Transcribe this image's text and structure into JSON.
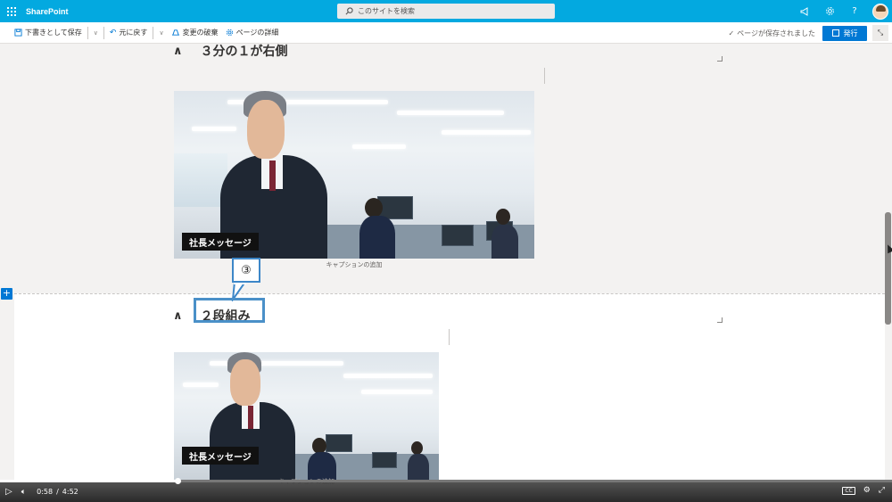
{
  "suite": {
    "brand": "SharePoint",
    "search_placeholder": "このサイトを検索",
    "icons": [
      "megaphone-icon",
      "gear-icon",
      "help-icon",
      "avatar"
    ]
  },
  "commandbar": {
    "save_draft": "下書きとして保存",
    "undo": "元に戻す",
    "discard": "変更の破棄",
    "page_details": "ページの詳細",
    "saved_status": "ページが保存されました",
    "publish": "発行"
  },
  "sections": [
    {
      "title": "３分の１が右側",
      "image_label": "社長メッセージ",
      "caption": "キャプションの追加"
    },
    {
      "title": "２段組み",
      "image_label": "社長メッセージ",
      "caption": "キャプションの追加"
    }
  ],
  "callout": {
    "number": "③"
  },
  "player": {
    "current_time": "0:58",
    "separator": "/",
    "duration": "4:52",
    "progress": 0.199
  },
  "colors": {
    "suitebar": "#03a9e0",
    "accent": "#0078d4",
    "callout": "#4a90c8"
  }
}
